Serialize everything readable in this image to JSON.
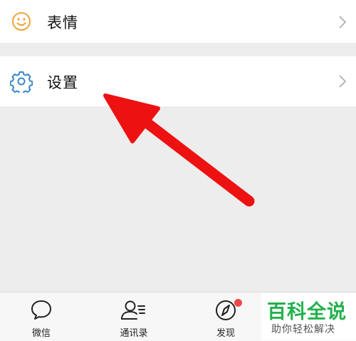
{
  "menu": {
    "items": [
      {
        "label": "表情",
        "icon": "emoji-icon",
        "icon_color": "#f0a23a"
      },
      {
        "label": "设置",
        "icon": "gear-icon",
        "icon_color": "#3a87c8"
      }
    ]
  },
  "annotation": {
    "arrow_color": "#ee1111"
  },
  "tabbar": {
    "tabs": [
      {
        "label": "微信",
        "icon": "chat-icon"
      },
      {
        "label": "通讯录",
        "icon": "contacts-icon"
      },
      {
        "label": "发现",
        "icon": "compass-icon",
        "badge_dot": true
      }
    ]
  },
  "watermark": {
    "title": "百科全说",
    "subtitle": "助你轻松解决"
  }
}
